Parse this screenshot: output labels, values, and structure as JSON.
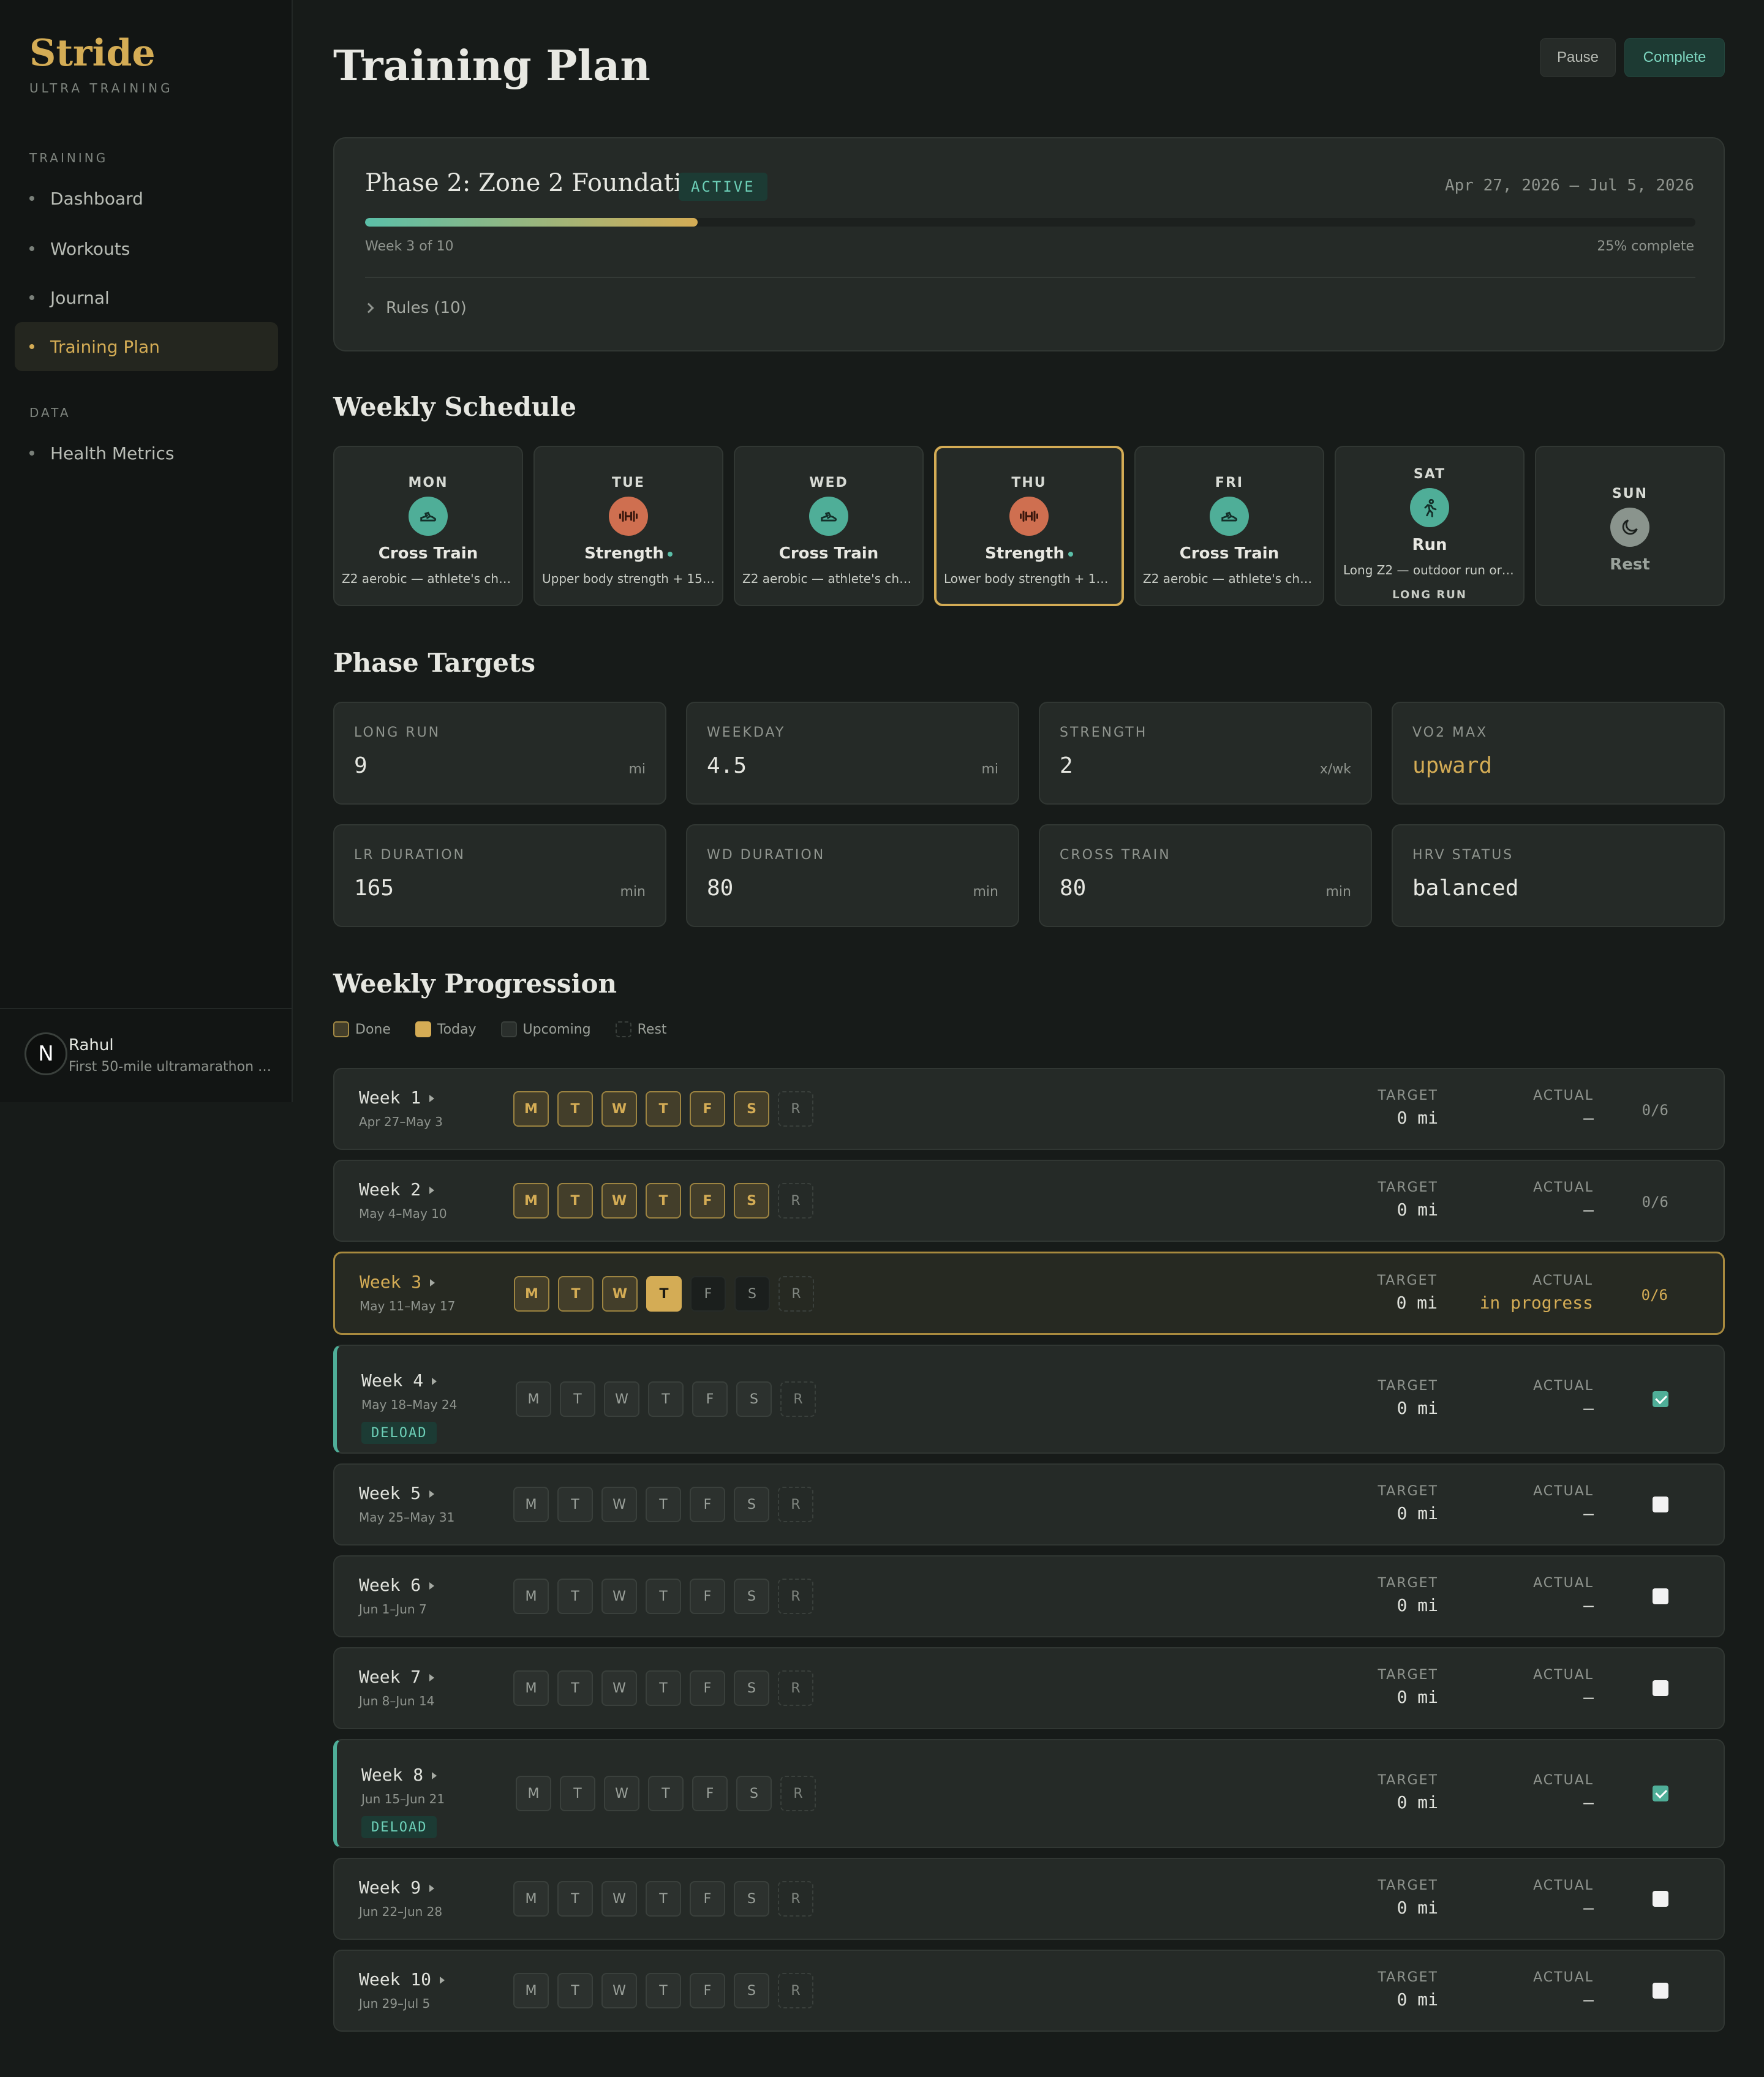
{
  "sidebar": {
    "brand": "Stride",
    "brand_sub": "ULTRA TRAINING",
    "sections": [
      {
        "heading": "TRAINING",
        "items": [
          "Dashboard",
          "Workouts",
          "Journal",
          "Training Plan"
        ]
      },
      {
        "heading": "DATA",
        "items": [
          "Health Metrics"
        ]
      }
    ],
    "active_item": "Training Plan",
    "user": {
      "initial": "N",
      "name": "Rahul",
      "goal": "First 50-mile ultramarathon by ..."
    }
  },
  "header": {
    "title": "Training Plan",
    "pause_label": "Pause",
    "complete_label": "Complete"
  },
  "phase": {
    "name": "Phase 2: Zone 2 Foundation",
    "status": "ACTIVE",
    "dates": "Apr 27, 2026 — Jul 5, 2026",
    "week_text": "Week 3 of 10",
    "progress_text": "25% complete",
    "progress_fraction": 0.25,
    "rules_label": "Rules (10)"
  },
  "schedule": {
    "title": "Weekly Schedule",
    "days": [
      {
        "day": "MON",
        "type": "Cross Train",
        "desc": "Z2 aerobic — athlete's choi...",
        "icon": "shoe-icon",
        "color": "teal"
      },
      {
        "day": "TUE",
        "type": "Strength",
        "desc": "Upper body strength + 15 ...",
        "icon": "dumbbell-icon",
        "color": "orange"
      },
      {
        "day": "WED",
        "type": "Cross Train",
        "desc": "Z2 aerobic — athlete's choi...",
        "icon": "shoe-icon",
        "color": "teal"
      },
      {
        "day": "THU",
        "type": "Strength",
        "desc": "Lower body strength + 15 ...",
        "icon": "dumbbell-icon",
        "color": "orange"
      },
      {
        "day": "FRI",
        "type": "Cross Train",
        "desc": "Z2 aerobic — athlete's choi...",
        "icon": "shoe-icon",
        "color": "teal"
      },
      {
        "day": "SAT",
        "type": "Run",
        "desc": "Long Z2 — outdoor run or t...",
        "tag": "LONG RUN",
        "icon": "runner-icon",
        "color": "teal"
      },
      {
        "day": "SUN",
        "type": "Rest",
        "icon": "moon-icon",
        "color": "gray"
      }
    ]
  },
  "targets": {
    "title": "Phase Targets",
    "items": [
      {
        "label": "LONG RUN",
        "value": "9",
        "unit": "mi"
      },
      {
        "label": "WEEKDAY",
        "value": "4.5",
        "unit": "mi"
      },
      {
        "label": "STRENGTH",
        "value": "2",
        "unit": "x/wk"
      },
      {
        "label": "VO2 MAX",
        "value": "upward",
        "unit": ""
      },
      {
        "label": "LR DURATION",
        "value": "165",
        "unit": "min"
      },
      {
        "label": "WD DURATION",
        "value": "80",
        "unit": "min"
      },
      {
        "label": "CROSS TRAIN",
        "value": "80",
        "unit": "min"
      },
      {
        "label": "HRV STATUS",
        "value": "balanced",
        "unit": ""
      }
    ]
  },
  "progression": {
    "title": "Weekly Progression",
    "legend": [
      "Done",
      "Today",
      "Upcoming",
      "Rest"
    ],
    "target_label": "TARGET",
    "actual_label": "ACTUAL",
    "deload_label": "DELOAD",
    "day_letters": [
      "M",
      "T",
      "W",
      "T",
      "F",
      "S",
      "R"
    ],
    "weeks": [
      {
        "name": "Week 1",
        "dates": "Apr 27–May 3",
        "target": "0 mi",
        "actual": "—",
        "count": "0/6",
        "state": "done"
      },
      {
        "name": "Week 2",
        "dates": "May 4–May 10",
        "target": "0 mi",
        "actual": "—",
        "count": "0/6",
        "state": "done"
      },
      {
        "name": "Week 3",
        "dates": "May 11–May 17",
        "target": "0 mi",
        "actual": "in progress",
        "count": "0/6",
        "state": "current"
      },
      {
        "name": "Week 4",
        "dates": "May 18–May 24",
        "target": "0 mi",
        "actual": "—",
        "deload": true,
        "checked": true
      },
      {
        "name": "Week 5",
        "dates": "May 25–May 31",
        "target": "0 mi",
        "actual": "—",
        "checked": false
      },
      {
        "name": "Week 6",
        "dates": "Jun 1–Jun 7",
        "target": "0 mi",
        "actual": "—",
        "checked": false
      },
      {
        "name": "Week 7",
        "dates": "Jun 8–Jun 14",
        "target": "0 mi",
        "actual": "—",
        "checked": false
      },
      {
        "name": "Week 8",
        "dates": "Jun 15–Jun 21",
        "target": "0 mi",
        "actual": "—",
        "deload": true,
        "checked": true
      },
      {
        "name": "Week 9",
        "dates": "Jun 22–Jun 28",
        "target": "0 mi",
        "actual": "—",
        "checked": false
      },
      {
        "name": "Week 10",
        "dates": "Jun 29–Jul 5",
        "target": "0 mi",
        "actual": "—",
        "checked": false
      }
    ]
  }
}
